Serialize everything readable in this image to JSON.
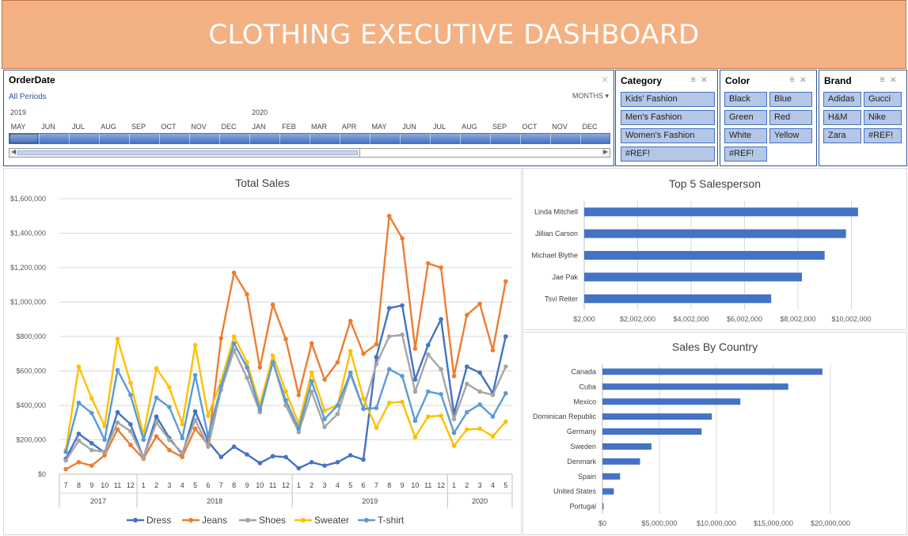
{
  "header": {
    "title": "CLOTHING EXECUTIVE DASHBOARD"
  },
  "timeline": {
    "title": "OrderDate",
    "period_label": "All Periods",
    "level": "MONTHS",
    "years": [
      "2019",
      "2020"
    ],
    "months": [
      "MAY",
      "JUN",
      "JUL",
      "AUG",
      "SEP",
      "OCT",
      "NOV",
      "DEC",
      "JAN",
      "FEB",
      "MAR",
      "APR",
      "MAY",
      "JUN",
      "JUL",
      "AUG",
      "SEP",
      "OCT",
      "NOV",
      "DEC"
    ]
  },
  "slicers": {
    "category": {
      "title": "Category",
      "items": [
        "Kids' Fashion",
        "Men's Fashion",
        "Women's Fashion",
        "#REF!"
      ]
    },
    "color": {
      "title": "Color",
      "items": [
        "Black",
        "Blue",
        "Green",
        "Red",
        "White",
        "Yellow",
        "#REF!"
      ]
    },
    "brand": {
      "title": "Brand",
      "items": [
        "Adidas",
        "Gucci",
        "H&M",
        "Nike",
        "Zara",
        "#REF!"
      ]
    }
  },
  "colors": {
    "header": "#f4b183",
    "accent": "#4472c4",
    "slicer_fill": "#b4c7e7"
  },
  "chart_data": [
    {
      "type": "line",
      "title": "Total Sales",
      "ylim": [
        0,
        1600000
      ],
      "y_ticks": [
        "$0",
        "$200,000",
        "$400,000",
        "$600,000",
        "$800,000",
        "$1,000,000",
        "$1,200,000",
        "$1,400,000",
        "$1,600,000"
      ],
      "categories": [
        "7",
        "8",
        "9",
        "10",
        "11",
        "12",
        "1",
        "2",
        "3",
        "4",
        "5",
        "6",
        "7",
        "8",
        "9",
        "10",
        "11",
        "12",
        "1",
        "2",
        "3",
        "4",
        "5",
        "6",
        "7",
        "8",
        "9",
        "10",
        "11",
        "12",
        "1",
        "2",
        "3",
        "4",
        "5"
      ],
      "year_groups": [
        {
          "year": "2017",
          "count": 6
        },
        {
          "year": "2018",
          "count": 12
        },
        {
          "year": "2019",
          "count": 12
        },
        {
          "year": "2020",
          "count": 5
        }
      ],
      "legend_position": "bottom",
      "grid": true,
      "series": [
        {
          "name": "Dress",
          "color": "#4472c4",
          "values": [
            90000,
            235000,
            180000,
            125000,
            360000,
            290000,
            95000,
            335000,
            210000,
            115000,
            365000,
            190000,
            100000,
            160000,
            115000,
            65000,
            105000,
            100000,
            35000,
            70000,
            50000,
            70000,
            110000,
            85000,
            680000,
            965000,
            980000,
            550000,
            750000,
            900000,
            350000,
            625000,
            590000,
            470000,
            800000
          ]
        },
        {
          "name": "Jeans",
          "color": "#ed7d31",
          "values": [
            30000,
            70000,
            50000,
            110000,
            260000,
            170000,
            90000,
            220000,
            140000,
            100000,
            265000,
            170000,
            790000,
            1170000,
            1045000,
            620000,
            985000,
            785000,
            460000,
            760000,
            550000,
            650000,
            890000,
            700000,
            755000,
            1500000,
            1370000,
            730000,
            1225000,
            1200000,
            570000,
            925000,
            990000,
            720000,
            1120000
          ]
        },
        {
          "name": "Shoes",
          "color": "#a5a5a5",
          "values": [
            80000,
            195000,
            140000,
            130000,
            300000,
            250000,
            95000,
            300000,
            200000,
            125000,
            315000,
            160000,
            490000,
            720000,
            560000,
            360000,
            660000,
            400000,
            245000,
            480000,
            275000,
            350000,
            580000,
            380000,
            640000,
            800000,
            810000,
            480000,
            695000,
            610000,
            320000,
            525000,
            480000,
            460000,
            625000
          ]
        },
        {
          "name": "Sweater",
          "color": "#ffc000",
          "values": [
            140000,
            625000,
            440000,
            280000,
            785000,
            530000,
            230000,
            615000,
            505000,
            290000,
            750000,
            340000,
            540000,
            800000,
            650000,
            400000,
            690000,
            480000,
            295000,
            590000,
            370000,
            400000,
            715000,
            440000,
            270000,
            415000,
            420000,
            215000,
            335000,
            340000,
            165000,
            260000,
            265000,
            220000,
            305000
          ]
        },
        {
          "name": "T-shirt",
          "color": "#5b9bd5",
          "values": [
            130000,
            415000,
            355000,
            200000,
            605000,
            460000,
            200000,
            445000,
            390000,
            210000,
            575000,
            220000,
            510000,
            760000,
            620000,
            375000,
            650000,
            430000,
            265000,
            540000,
            320000,
            400000,
            590000,
            380000,
            385000,
            610000,
            570000,
            310000,
            480000,
            465000,
            240000,
            360000,
            405000,
            335000,
            470000
          ]
        }
      ]
    },
    {
      "type": "bar",
      "orientation": "horizontal",
      "title": "Top 5 Salesperson",
      "categories": [
        "Linda Mitchell",
        "Jillian Carson",
        "Michael Blythe",
        "Jae Pak",
        "Tsvi Reiter"
      ],
      "values": [
        10250000,
        9800000,
        9000000,
        8150000,
        7000000
      ],
      "xlim": [
        2000,
        11000000
      ],
      "x_ticks": [
        "$2,000",
        "$2,002,000",
        "$4,002,000",
        "$6,002,000",
        "$8,002,000",
        "$10,002,000"
      ],
      "color": "#4472c4"
    },
    {
      "type": "bar",
      "orientation": "horizontal",
      "title": "Sales By Country",
      "categories": [
        "Canada",
        "Cuba",
        "Mexico",
        "Dominican Republic",
        "Germany",
        "Sweden",
        "Denmark",
        "Spain",
        "United States",
        "Portugal"
      ],
      "values": [
        19300000,
        16300000,
        12100000,
        9600000,
        8700000,
        4300000,
        3300000,
        1550000,
        1000000,
        100000
      ],
      "xlim": [
        0,
        21000000
      ],
      "x_ticks": [
        "$0",
        "$5,000,000",
        "$10,000,000",
        "$15,000,000",
        "$20,000,000"
      ],
      "color": "#4472c4"
    }
  ]
}
